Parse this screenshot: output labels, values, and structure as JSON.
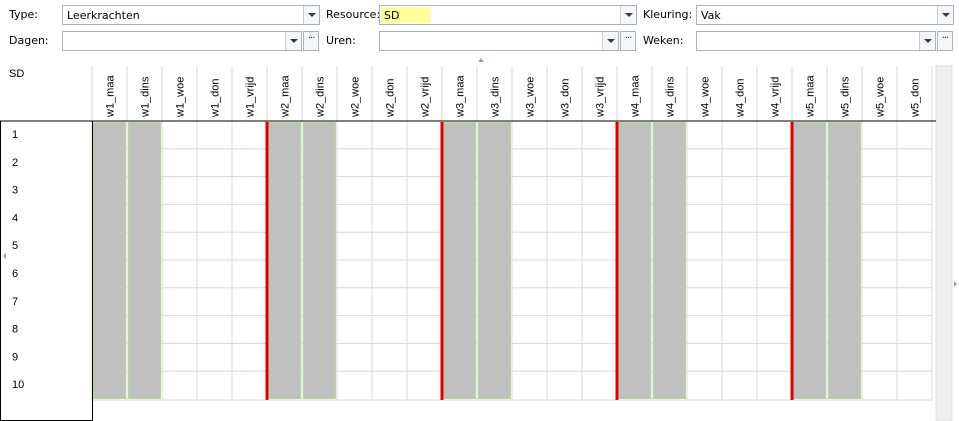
{
  "filters": {
    "type": {
      "label": "Type:",
      "value": "Leerkrachten"
    },
    "resource": {
      "label": "Resource:",
      "value": "SD"
    },
    "kleuring": {
      "label": "Kleuring:",
      "value": "Vak"
    },
    "dagen": {
      "label": "Dagen:",
      "value": "",
      "more": "···"
    },
    "uren": {
      "label": "Uren:",
      "value": "",
      "more": "···"
    },
    "weken": {
      "label": "Weken:",
      "value": "",
      "more": "···"
    }
  },
  "grid": {
    "corner_label": "SD",
    "columns": [
      "w1_maa",
      "w1_dins",
      "w1_woe",
      "w1_don",
      "w1_vrijd",
      "w2_maa",
      "w2_dins",
      "w2_woe",
      "w2_don",
      "w2_vrijd",
      "w3_maa",
      "w3_dins",
      "w3_woe",
      "w3_don",
      "w3_vrijd",
      "w4_maa",
      "w4_dins",
      "w4_woe",
      "w4_don",
      "w4_vrijd",
      "w5_maa",
      "w5_dins",
      "w5_woe",
      "w5_don"
    ],
    "rows": [
      "1",
      "2",
      "3",
      "4",
      "5",
      "6",
      "7",
      "8",
      "9",
      "10"
    ],
    "scheduled_columns": [
      "w1_maa",
      "w1_dins",
      "w2_maa",
      "w2_dins",
      "w3_maa",
      "w3_dins",
      "w4_maa",
      "w4_dins",
      "w5_maa",
      "w5_dins"
    ],
    "week_separator_before": [
      "w2_maa",
      "w3_maa",
      "w4_maa",
      "w5_maa"
    ]
  },
  "colors": {
    "block_fill": "#c0c0c0",
    "block_border": "#b4d79a",
    "week_separator": "#dd0000",
    "grid_line": "#d8d8d8",
    "resource_highlight": "#ffff9c"
  }
}
